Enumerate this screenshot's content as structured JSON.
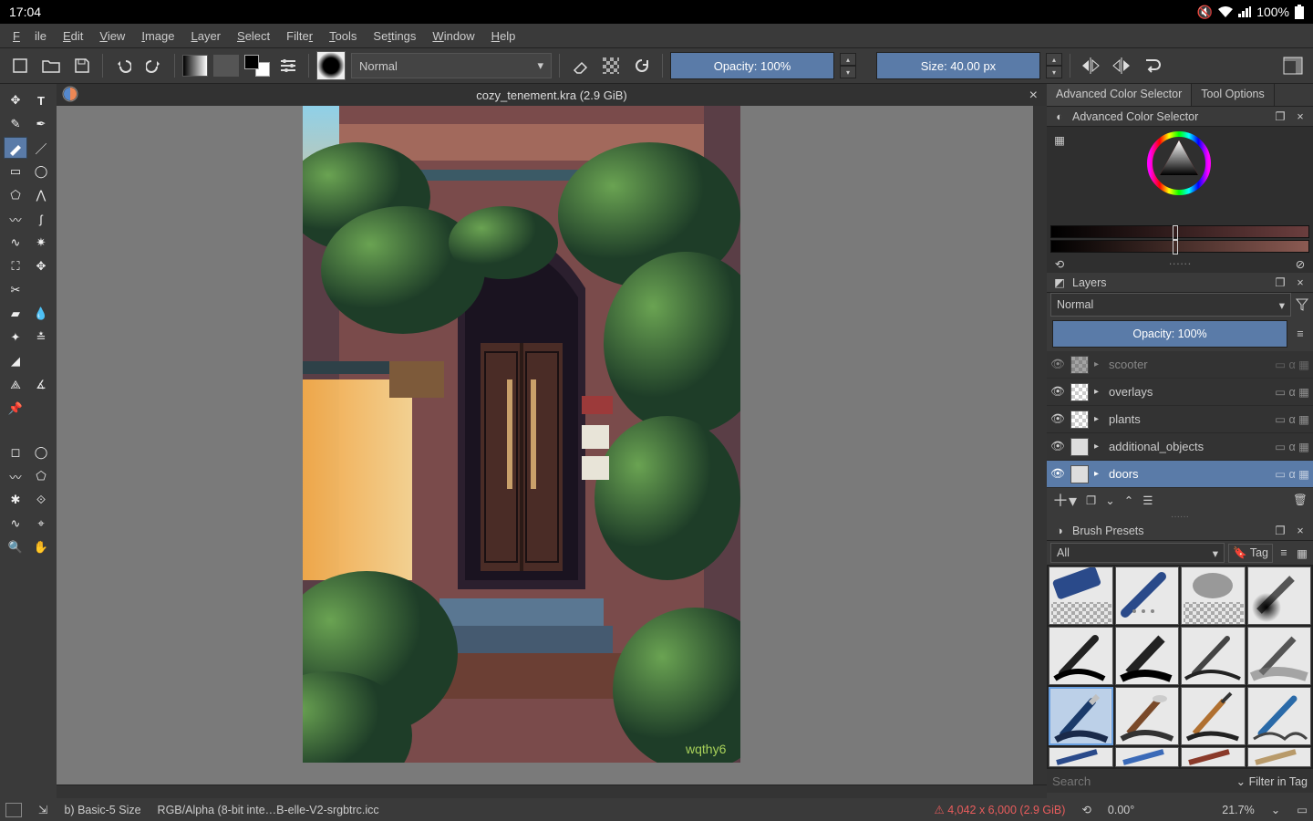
{
  "android": {
    "clock": "17:04",
    "battery": "100%"
  },
  "menu": {
    "file": "File",
    "edit": "Edit",
    "view": "View",
    "image": "Image",
    "layer": "Layer",
    "select": "Select",
    "filter": "Filter",
    "tools": "Tools",
    "settings": "Settings",
    "window": "Window",
    "help": "Help"
  },
  "toolbar": {
    "blend_mode": "Normal",
    "opacity_label": "Opacity: 100%",
    "size_label": "Size: 40.00 px"
  },
  "document": {
    "tab_title": "cozy_tenement.kra (2.9 GiB)"
  },
  "right_tabs": {
    "acs": "Advanced Color Selector",
    "tool_options": "Tool Options"
  },
  "acs_header": "Advanced Color Selector",
  "layers_panel": {
    "header": "Layers",
    "blend_mode": "Normal",
    "opacity_label": "Opacity:  100%",
    "items": [
      {
        "name": "scooter",
        "selected": false,
        "dim": true
      },
      {
        "name": "overlays",
        "selected": false
      },
      {
        "name": "plants",
        "selected": false
      },
      {
        "name": "additional_objects",
        "selected": false
      },
      {
        "name": "doors",
        "selected": true
      }
    ]
  },
  "brush_panel": {
    "header": "Brush Presets",
    "filter": "All",
    "tag_label": "Tag",
    "search_placeholder": "Search",
    "filter_in_tag": "Filter in Tag"
  },
  "status": {
    "brush": "b) Basic-5 Size",
    "profile": "RGB/Alpha (8-bit inte…B-elle-V2-srgbtrc.icc",
    "dims": "4,042 x 6,000 (2.9 GiB)",
    "angle": "0.00°",
    "zoom": "21.7%"
  }
}
